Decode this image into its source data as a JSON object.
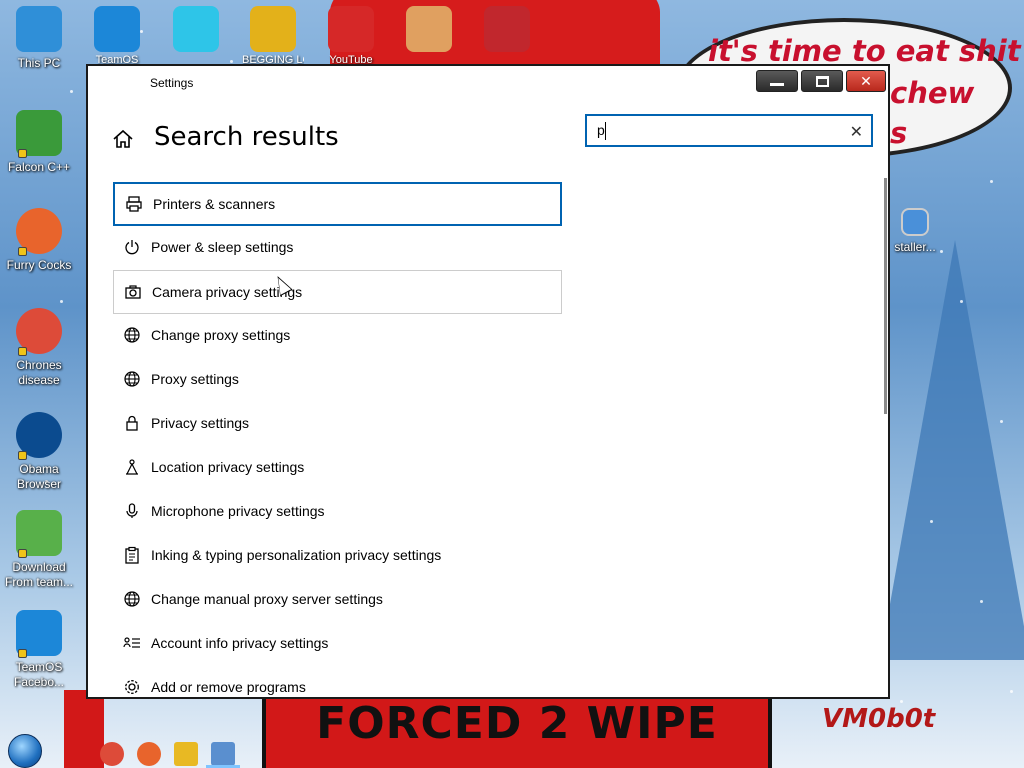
{
  "desktop": {
    "icons_left": [
      {
        "name": "this-pc",
        "label": "This PC",
        "color": "#2f8fd8"
      },
      {
        "name": "falcon-cpp",
        "label": "Falcon C++",
        "color": "#3a9a3a"
      },
      {
        "name": "furry-cocks",
        "label": "Furry Cocks",
        "color": "#e8642c"
      },
      {
        "name": "chrones-disease",
        "label": "Chrones disease",
        "color": "#dd4b39"
      },
      {
        "name": "obama-browser",
        "label": "Obama Browser",
        "color": "#0b4b8f"
      },
      {
        "name": "download-from-team",
        "label": "Download From team...",
        "color": "#58b04a"
      },
      {
        "name": "teamos-facebook",
        "label": "TeamOS Facebo...",
        "color": "#1c87d8"
      }
    ],
    "icons_top": [
      {
        "name": "teamos",
        "label": "TeamOS",
        "color": "#1c87d8"
      },
      {
        "name": "diamond",
        "label": "",
        "color": "#2ec5e8"
      },
      {
        "name": "begging",
        "label": "BEGGING LOL",
        "color": "#e3b11a"
      },
      {
        "name": "angry-birds",
        "label": "YouTube",
        "color": "#d62828"
      },
      {
        "name": "candy",
        "label": "",
        "color": "#e0a060"
      },
      {
        "name": "red-icon",
        "label": "",
        "color": "#c1272d"
      }
    ],
    "installer_label": "staller...",
    "speech_bubble": {
      "line1": "it's time to eat shit",
      "line2": "chew",
      "line3": "s"
    },
    "shirt_text": "FORCED 2 WIPE",
    "watermark": "VM0b0t"
  },
  "window": {
    "title": "Settings",
    "buttons": {
      "minimize": "",
      "maximize": "",
      "close": "✕"
    },
    "page_title": "Search results",
    "search": {
      "value": "p",
      "clear": "✕"
    },
    "results": [
      {
        "label": "Printers & scanners",
        "icon": "printer-icon",
        "state": "selected"
      },
      {
        "label": "Power & sleep settings",
        "icon": "power-icon",
        "state": ""
      },
      {
        "label": "Camera privacy settings",
        "icon": "camera-icon",
        "state": "hover"
      },
      {
        "label": "Change proxy settings",
        "icon": "globe-icon",
        "state": ""
      },
      {
        "label": "Proxy settings",
        "icon": "globe-icon",
        "state": ""
      },
      {
        "label": "Privacy settings",
        "icon": "lock-icon",
        "state": ""
      },
      {
        "label": "Location privacy settings",
        "icon": "location-icon",
        "state": ""
      },
      {
        "label": "Microphone privacy settings",
        "icon": "microphone-icon",
        "state": ""
      },
      {
        "label": "Inking & typing personalization privacy settings",
        "icon": "clipboard-icon",
        "state": ""
      },
      {
        "label": "Change manual proxy server settings",
        "icon": "globe-icon",
        "state": ""
      },
      {
        "label": "Account info privacy settings",
        "icon": "account-info-icon",
        "state": ""
      },
      {
        "label": "Add or remove programs",
        "icon": "gear-icon",
        "state": ""
      }
    ]
  },
  "taskbar": {
    "items": [
      {
        "name": "chrome",
        "color": "#dd4b39"
      },
      {
        "name": "firefox",
        "color": "#e8642c"
      },
      {
        "name": "file-explorer",
        "color": "#e8b923"
      },
      {
        "name": "settings",
        "color": "#5a8fcf"
      }
    ]
  },
  "colors": {
    "accent": "#0063b1",
    "selected_border": "#0063b1",
    "hover_border": "#cccccc"
  }
}
